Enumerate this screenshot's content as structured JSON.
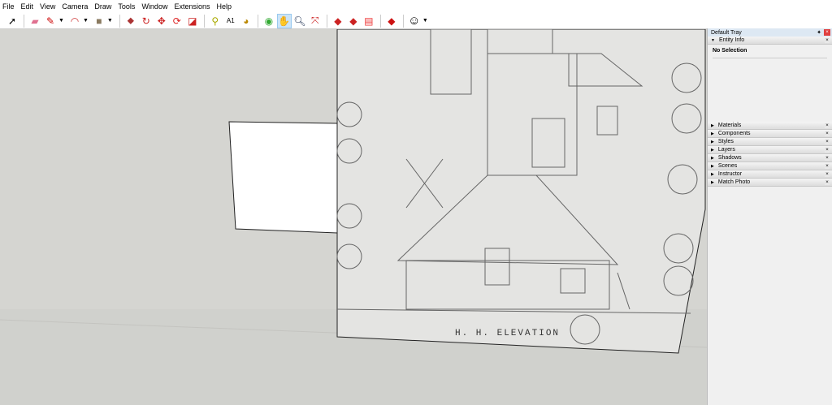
{
  "menu": [
    "File",
    "Edit",
    "View",
    "Camera",
    "Draw",
    "Tools",
    "Window",
    "Extensions",
    "Help"
  ],
  "toolbar": {
    "icons": [
      "select-icon",
      "eraser-icon",
      "pencil-icon",
      "arc-icon",
      "rectangle-icon",
      "push-pull-icon",
      "follow-me-icon",
      "move-icon",
      "rotate-icon",
      "scale-icon",
      "tape-measure-icon",
      "text-icon",
      "paint-bucket-icon",
      "orbit-icon",
      "pan-icon",
      "zoom-icon",
      "zoom-extents-icon",
      "warehouse-icon",
      "extension-warehouse-icon",
      "send-to-layout-icon",
      "extension-manager-icon",
      "account-icon"
    ],
    "active": "pan-icon"
  },
  "tray": {
    "title": "Default Tray",
    "entity_info": {
      "label": "Entity Info",
      "status": "No Selection"
    },
    "panels": [
      "Materials",
      "Components",
      "Styles",
      "Layers",
      "Shadows",
      "Scenes",
      "Instructor",
      "Match Photo"
    ]
  },
  "viewport": {
    "drawing_caption": "H. H. ELEVATION"
  },
  "colors": {
    "sky": "#d5d5d1",
    "ground": "#d0d1cd",
    "active_tool": "#cce4f7"
  }
}
